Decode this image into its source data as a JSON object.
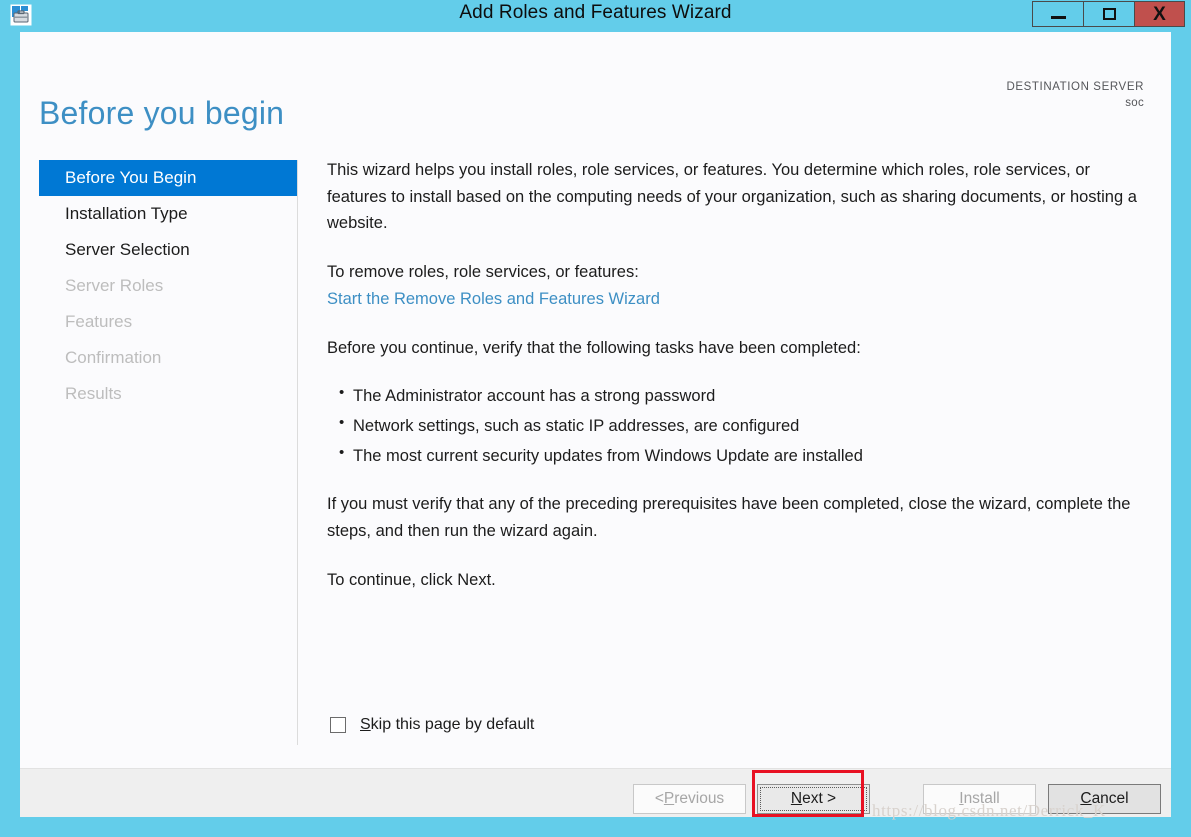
{
  "window": {
    "title": "Add Roles and Features Wizard",
    "icon": "server-manager-icon",
    "accent_color": "#63cdea",
    "close_color": "#c0504d",
    "controls": {
      "minimize_label": "",
      "maximize_label": "",
      "close_label": "X"
    }
  },
  "header": {
    "page_title": "Before you begin",
    "page_title_color": "#3d8fc4",
    "destination_label": "DESTINATION SERVER",
    "destination_server": "soc"
  },
  "sidebar": {
    "items": [
      {
        "label": "Before You Begin",
        "state": "selected"
      },
      {
        "label": "Installation Type",
        "state": "enabled"
      },
      {
        "label": "Server Selection",
        "state": "enabled"
      },
      {
        "label": "Server Roles",
        "state": "disabled"
      },
      {
        "label": "Features",
        "state": "disabled"
      },
      {
        "label": "Confirmation",
        "state": "disabled"
      },
      {
        "label": "Results",
        "state": "disabled"
      }
    ],
    "selected_color": "#0078d4"
  },
  "content": {
    "intro_paragraph": "This wizard helps you install roles, role services, or features. You determine which roles, role services, or features to install based on the computing needs of your organization, such as sharing documents, or hosting a website.",
    "remove_intro": "To remove roles, role services, or features:",
    "remove_link": "Start the Remove Roles and Features Wizard",
    "link_color": "#3d8fc4",
    "verify_intro": "Before you continue, verify that the following tasks have been completed:",
    "tasks": [
      "The Administrator account has a strong password",
      "Network settings, such as static IP addresses, are configured",
      "The most current security updates from Windows Update are installed"
    ],
    "prerequisite_paragraph": "If you must verify that any of the preceding prerequisites have been completed, close the wizard, complete the steps, and then run the wizard again.",
    "continue_paragraph": "To continue, click Next."
  },
  "skip_option": {
    "label_prefix": "S",
    "label_rest": "kip this page by default",
    "checked": false
  },
  "footer": {
    "buttons": [
      {
        "id": "previous",
        "label": "< Previous",
        "accel": "P",
        "state": "disabled",
        "focused": false
      },
      {
        "id": "next",
        "label": "Next >",
        "accel": "N",
        "state": "enabled",
        "focused": true
      },
      {
        "id": "install",
        "label": "Install",
        "accel": "I",
        "state": "disabled",
        "focused": false
      },
      {
        "id": "cancel",
        "label": "Cancel",
        "accel": "C",
        "state": "enabled",
        "focused": false
      }
    ]
  },
  "annotation": {
    "highlight_target": "next-button",
    "highlight_color": "#e81123"
  },
  "watermark": {
    "text": "https://blog.csdn.net/Derrick_K"
  }
}
